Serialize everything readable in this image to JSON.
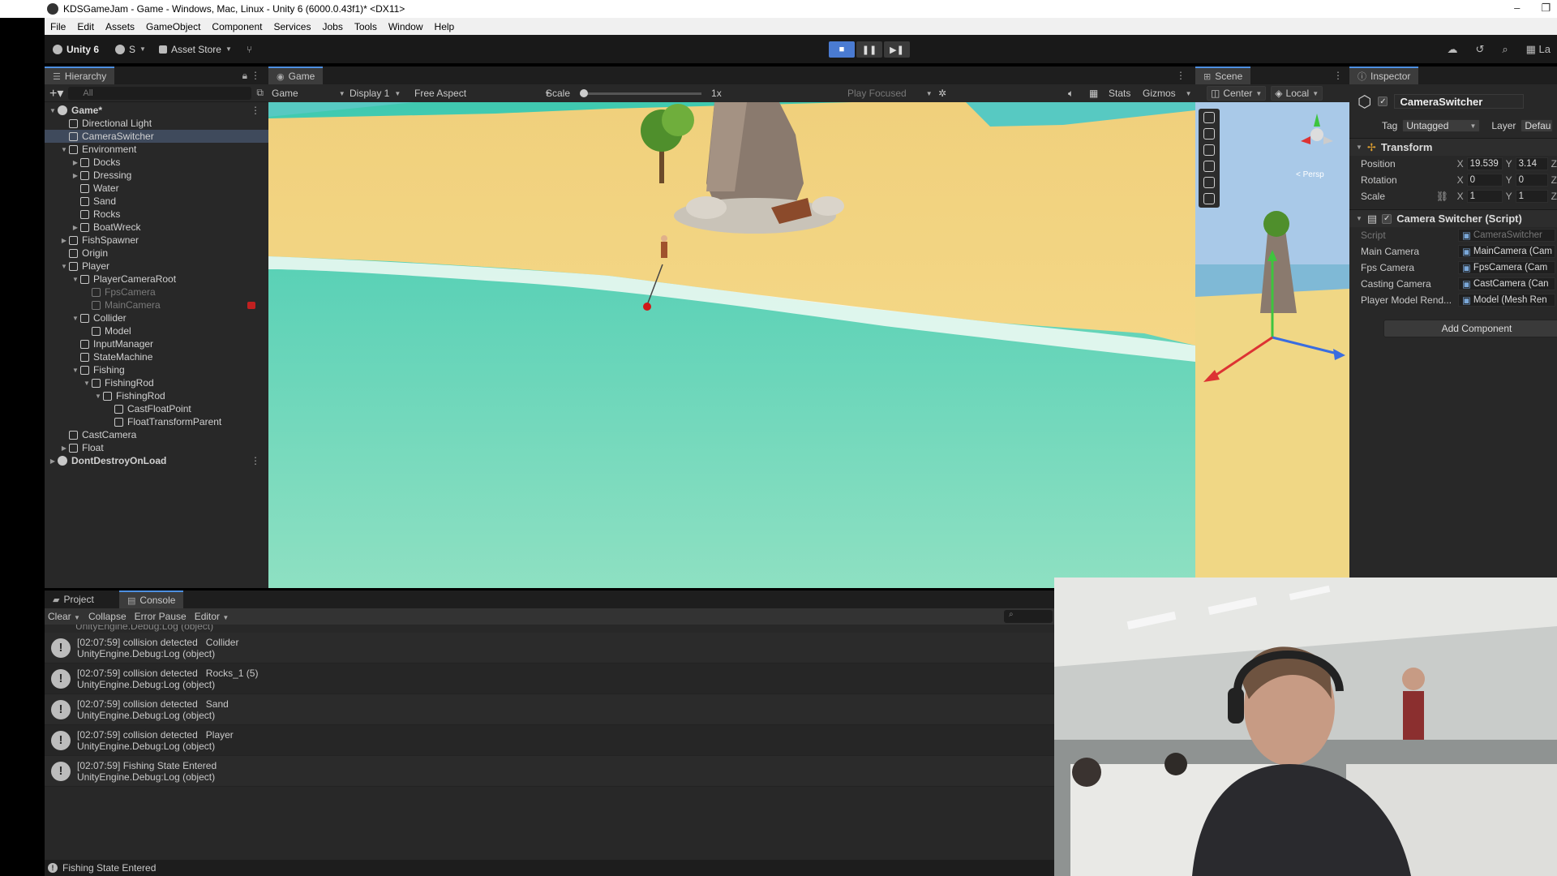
{
  "window": {
    "title": "KDSGameJam - Game - Windows, Mac, Linux - Unity 6 (6000.0.43f1)* <DX11>",
    "minimize": "–",
    "restore": "❐"
  },
  "menu": [
    "File",
    "Edit",
    "Assets",
    "GameObject",
    "Component",
    "Services",
    "Jobs",
    "Tools",
    "Window",
    "Help"
  ],
  "toolbar": {
    "product": "Unity 6",
    "account": "S",
    "asset_store": "Asset Store",
    "play_buttons": [
      "■",
      "❚❚",
      "▶❚"
    ],
    "right_cut_label": "La"
  },
  "hierarchy": {
    "tab": "Hierarchy",
    "search_placeholder": "All",
    "items": [
      {
        "label": "Game*",
        "depth": 0,
        "expanded": true,
        "scene": true
      },
      {
        "label": "Directional Light",
        "depth": 1
      },
      {
        "label": "CameraSwitcher",
        "depth": 1,
        "selected": true
      },
      {
        "label": "Environment",
        "depth": 1,
        "expanded": true,
        "parent": true
      },
      {
        "label": "Docks",
        "depth": 2,
        "collapsed": true
      },
      {
        "label": "Dressing",
        "depth": 2,
        "collapsed": true
      },
      {
        "label": "Water",
        "depth": 2
      },
      {
        "label": "Sand",
        "depth": 2
      },
      {
        "label": "Rocks",
        "depth": 2
      },
      {
        "label": "BoatWreck",
        "depth": 2,
        "collapsed": true
      },
      {
        "label": "FishSpawner",
        "depth": 1,
        "collapsed": true
      },
      {
        "label": "Origin",
        "depth": 1
      },
      {
        "label": "Player",
        "depth": 1,
        "expanded": true,
        "parent": true
      },
      {
        "label": "PlayerCameraRoot",
        "depth": 2,
        "expanded": true,
        "parent": true
      },
      {
        "label": "FpsCamera",
        "depth": 3,
        "dim": true
      },
      {
        "label": "MainCamera",
        "depth": 3,
        "dim": true,
        "flag": true
      },
      {
        "label": "Collider",
        "depth": 2,
        "expanded": true,
        "parent": true
      },
      {
        "label": "Model",
        "depth": 3
      },
      {
        "label": "InputManager",
        "depth": 2
      },
      {
        "label": "StateMachine",
        "depth": 2
      },
      {
        "label": "Fishing",
        "depth": 2,
        "expanded": true,
        "parent": true
      },
      {
        "label": "FishingRod",
        "depth": 3,
        "expanded": true,
        "parent": true
      },
      {
        "label": "FishingRod",
        "depth": 4,
        "expanded": true,
        "parent": true
      },
      {
        "label": "CastFloatPoint",
        "depth": 5
      },
      {
        "label": "FloatTransformParent",
        "depth": 5
      },
      {
        "label": "CastCamera",
        "depth": 1
      },
      {
        "label": "Float",
        "depth": 1,
        "collapsed": true
      },
      {
        "label": "DontDestroyOnLoad",
        "depth": 0,
        "collapsed": true,
        "scene": true
      }
    ]
  },
  "game_view": {
    "tab": "Game",
    "mode": "Game",
    "display": "Display 1",
    "aspect": "Free Aspect",
    "scale_label": "Scale",
    "scale_value": "1x",
    "play_focused": "Play Focused",
    "stats": "Stats",
    "gizmos": "Gizmos"
  },
  "scene_view": {
    "tab": "Scene",
    "pivot": "Center",
    "space": "Local",
    "persp": "< Persp"
  },
  "inspector": {
    "tab": "Inspector",
    "object_name": "CameraSwitcher",
    "tag_label": "Tag",
    "tag_value": "Untagged",
    "layer_label": "Layer",
    "layer_value": "Defau",
    "transform": {
      "title": "Transform",
      "position_label": "Position",
      "rotation_label": "Rotation",
      "scale_label": "Scale",
      "position": {
        "x": "19.539",
        "y": "3.14"
      },
      "rotation": {
        "x": "0",
        "y": "0"
      },
      "scale": {
        "x": "1",
        "y": "1"
      },
      "axis_x": "X",
      "axis_y": "Y",
      "axis_z": "Z"
    },
    "script_component": {
      "title": "Camera Switcher (Script)",
      "rows": [
        {
          "label": "Script",
          "value": "CameraSwitcher",
          "dim": true
        },
        {
          "label": "Main Camera",
          "value": "MainCamera (Cam"
        },
        {
          "label": "Fps Camera",
          "value": "FpsCamera (Cam"
        },
        {
          "label": "Casting Camera",
          "value": "CastCamera (Can"
        },
        {
          "label": "Player Model Rend...",
          "value": "Model (Mesh Ren"
        }
      ]
    },
    "add_component": "Add Component"
  },
  "console": {
    "tabs": [
      "Project",
      "Console"
    ],
    "tools": [
      "Clear",
      "Collapse",
      "Error Pause",
      "Editor"
    ],
    "top_cut_line": "UnityEngine.Debug:Log (object)",
    "logs": [
      {
        "msg": "[02:07:59] collision detected   Collider",
        "trace": "UnityEngine.Debug:Log (object)"
      },
      {
        "msg": "[02:07:59] collision detected   Rocks_1 (5)",
        "trace": "UnityEngine.Debug:Log (object)"
      },
      {
        "msg": "[02:07:59] collision detected   Sand",
        "trace": "UnityEngine.Debug:Log (object)"
      },
      {
        "msg": "[02:07:59] collision detected   Player",
        "trace": "UnityEngine.Debug:Log (object)"
      },
      {
        "msg": "[02:07:59] Fishing State Entered",
        "trace": "UnityEngine.Debug:Log (object)"
      }
    ],
    "status": "Fishing State Entered"
  },
  "colors": {
    "accent": "#4d8fe0",
    "selection": "#3f4a5c",
    "sand": "#f1d279",
    "water": "#63d3b6"
  }
}
